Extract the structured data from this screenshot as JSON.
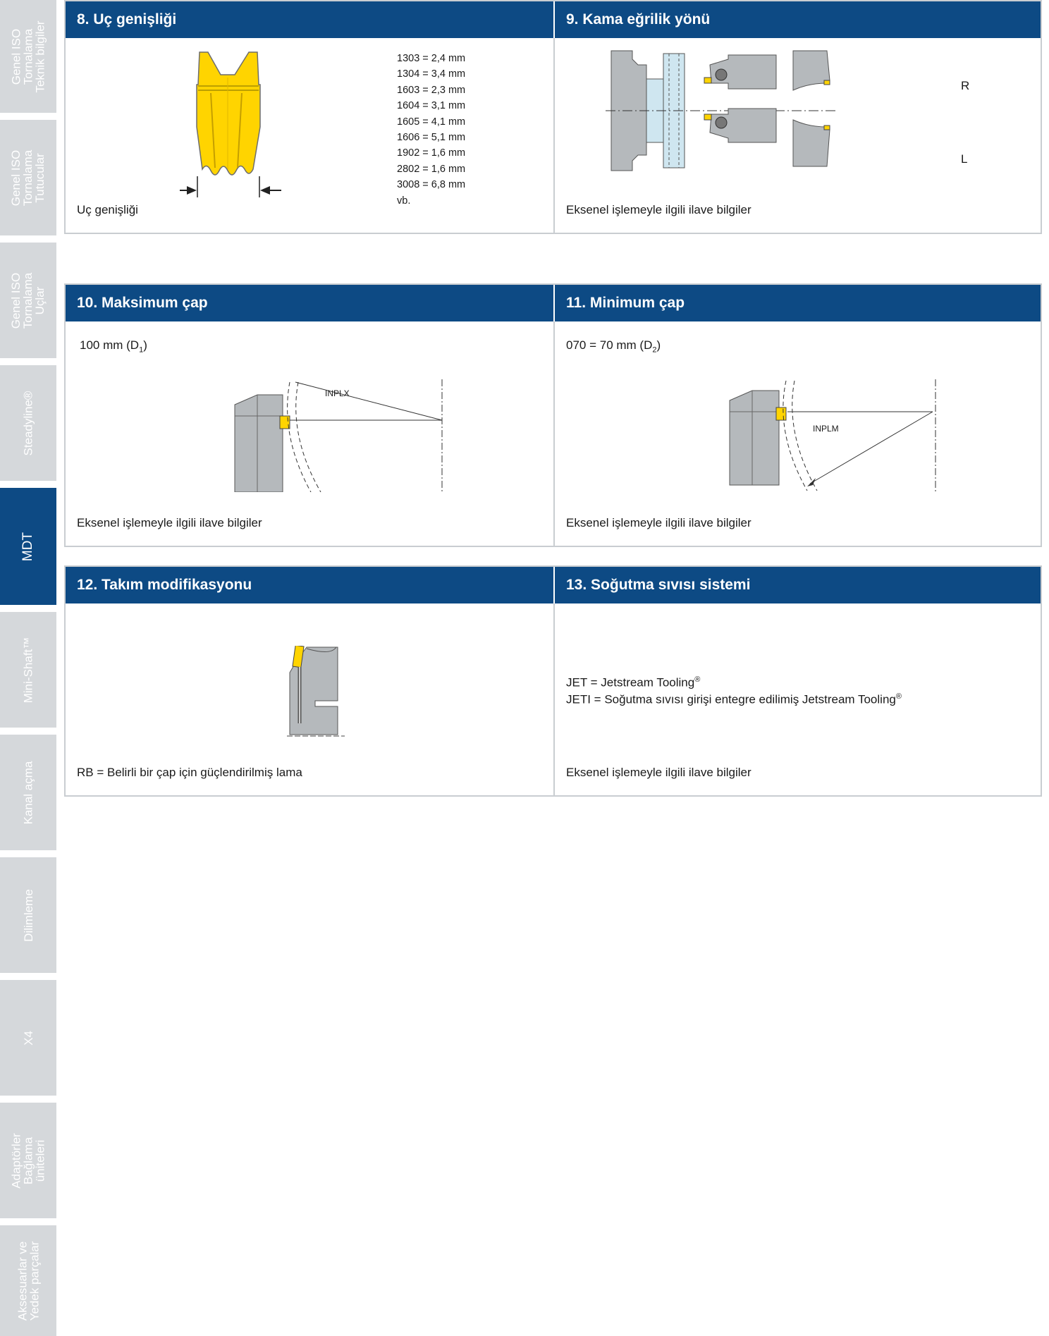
{
  "sidebar": {
    "tabs": [
      {
        "label": "Genel ISO\nTornalama\nTeknik bilgiler",
        "active": false
      },
      {
        "label": "Genel ISO\nTornalama\nTutucular",
        "active": false
      },
      {
        "label": "Genel ISO\nTornalama\nUçlar",
        "active": false
      },
      {
        "label": "Steadyline®",
        "active": false
      },
      {
        "label": "MDT",
        "active": true
      },
      {
        "label": "Mini-Shaft™",
        "active": false
      },
      {
        "label": "Kanal açma",
        "active": false
      },
      {
        "label": "Dilimleme",
        "active": false
      },
      {
        "label": "X4",
        "active": false
      },
      {
        "label": "Adaptörler\nBağlama\nüniteleri",
        "active": false
      },
      {
        "label": "Aksesuarlar ve\nYedek parçalar",
        "active": false
      }
    ]
  },
  "sections": {
    "s8": {
      "title": "8. Uç genişliği",
      "widths": "1303 = 2,4 mm\n1304 = 3,4 mm\n1603 = 2,3 mm\n1604 = 3,1 mm\n1605 = 4,1 mm\n1606 = 5,1 mm\n1902 = 1,6 mm\n2802 = 1,6 mm\n3008 = 6,8 mm\nvb.",
      "caption": "Uç genişliği"
    },
    "s9": {
      "title": "9. Kama eğrilik yönü",
      "label_r": "R",
      "label_l": "L",
      "caption": "Eksenel işlemeyle ilgili ilave bilgiler"
    },
    "s10": {
      "title": "10. Maksimum çap",
      "value": "100 mm (D",
      "value_sub": "1",
      "value_end": ")",
      "diagram_label": "INPLX",
      "caption": "Eksenel işlemeyle ilgili ilave bilgiler"
    },
    "s11": {
      "title": "11. Minimum çap",
      "value": "070 = 70 mm (D",
      "value_sub": "2",
      "value_end": ")",
      "diagram_label": "INPLM",
      "caption": "Eksenel işlemeyle ilgili ilave bilgiler"
    },
    "s12": {
      "title": "12. Takım modifikasyonu",
      "caption": "RB = Belirli bir çap için güçlendirilmiş lama"
    },
    "s13": {
      "title": "13. Soğutma sıvısı sistemi",
      "line1": "JET = Jetstream Tooling",
      "line2": "JETI = Soğutma sıvısı girişi entegre edilimiş Jetstream Tooling",
      "reg": "®",
      "caption": "Eksenel işlemeyle ilgili ilave bilgiler"
    }
  }
}
